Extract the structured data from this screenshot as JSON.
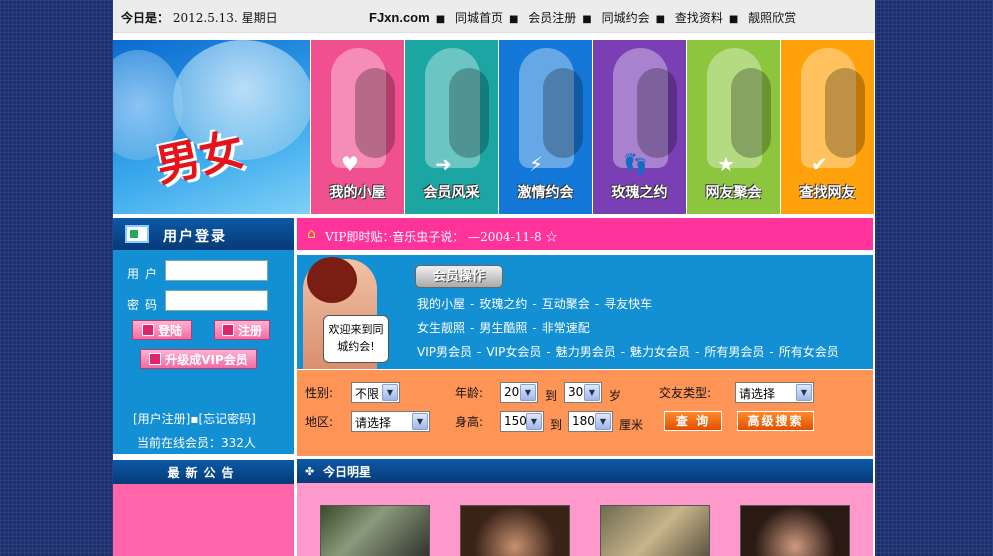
{
  "topbar": {
    "date_label": "今日是：",
    "date": "2012.5.13.",
    "weekday": "星期日",
    "site": "FJxn.com",
    "nav": [
      "同城首页",
      "会员注册",
      "同城约会",
      "查找资料",
      "靓照欣赏"
    ],
    "sep": "■"
  },
  "banner": {
    "logo": "男女",
    "cells": [
      {
        "label": "我的小屋",
        "color": "#f0508f",
        "sym": "♥"
      },
      {
        "label": "会员风采",
        "color": "#1ba6a3",
        "sym": "➜"
      },
      {
        "label": "激情约会",
        "color": "#1478d8",
        "sym": "⚡"
      },
      {
        "label": "玫瑰之约",
        "color": "#7a3fb5",
        "sym": "👣"
      },
      {
        "label": "网友聚会",
        "color": "#8cc63f",
        "sym": "★"
      },
      {
        "label": "查找网友",
        "color": "#ffa10a",
        "sym": "✔"
      }
    ]
  },
  "login": {
    "title": "用户登录",
    "user_label": "用户",
    "pass_label": "密码",
    "login_btn": "登陆",
    "register_btn": "注册",
    "vip_btn": "升级成VIP会员",
    "links": "[用户注册]▪[忘记密码]",
    "online": "当前在线会员：332人"
  },
  "notice": {
    "title": "最新公告"
  },
  "vip": {
    "text": "VIP即时贴：·音乐虫子说： —2004-11-8 ☆"
  },
  "member": {
    "bubble": "欢迎来到同城约会!",
    "title": "会员操作",
    "row1": [
      "我的小屋",
      "玫瑰之约",
      "互动聚会",
      "寻友快车"
    ],
    "row2": [
      "女生靓照",
      "男生酷照",
      "非常速配"
    ],
    "row3": [
      "VIP男会员",
      "VIP女会员",
      "魅力男会员",
      "魅力女会员",
      "所有男会员",
      "所有女会员"
    ],
    "dash": "-"
  },
  "search": {
    "gender_label": "性别:",
    "gender": "不限",
    "age_label": "年龄:",
    "age_from": "20",
    "to": "到",
    "age_to": "30",
    "age_unit": "岁",
    "type_label": "交友类型:",
    "type": "请选择",
    "area_label": "地区:",
    "area": "请选择",
    "height_label": "身高:",
    "h_from": "150",
    "h_to": "180",
    "h_unit": "厘米",
    "query_btn": "查 询",
    "adv_btn": "高级搜索"
  },
  "stars": {
    "title": "今日明星"
  }
}
